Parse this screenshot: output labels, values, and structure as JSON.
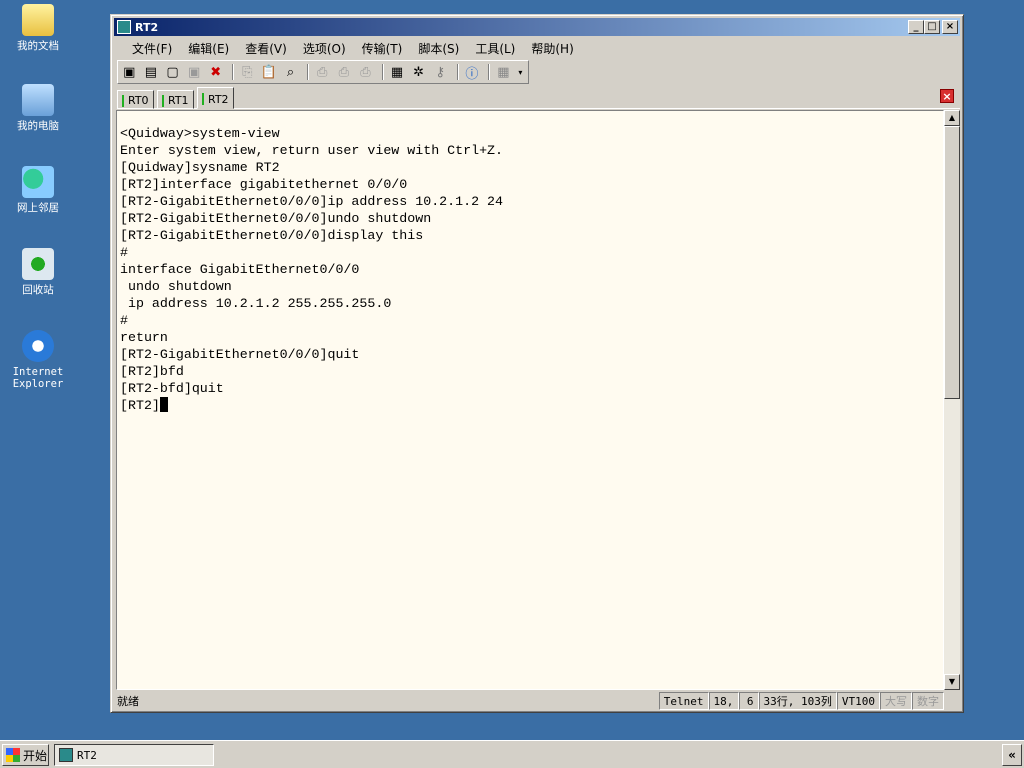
{
  "desktop": {
    "icons": [
      {
        "label": "我的文档",
        "icon": "folder-documents-icon"
      },
      {
        "label": "我的电脑",
        "icon": "computer-icon"
      },
      {
        "label": "网上邻居",
        "icon": "network-icon"
      },
      {
        "label": "回收站",
        "icon": "recycle-bin-icon"
      },
      {
        "label": "Internet Explorer",
        "icon": "internet-explorer-icon"
      }
    ]
  },
  "window": {
    "title": "RT2",
    "menu": [
      "文件(F)",
      "编辑(E)",
      "查看(V)",
      "选项(O)",
      "传输(T)",
      "脚本(S)",
      "工具(L)",
      "帮助(H)"
    ],
    "tabs": [
      "RT0",
      "RT1",
      "RT2"
    ],
    "active_tab": "RT2",
    "terminal_lines": [
      "<Quidway>system-view",
      "Enter system view, return user view with Ctrl+Z.",
      "[Quidway]sysname RT2",
      "[RT2]interface gigabitethernet 0/0/0",
      "[RT2-GigabitEthernet0/0/0]ip address 10.2.1.2 24",
      "[RT2-GigabitEthernet0/0/0]undo shutdown",
      "[RT2-GigabitEthernet0/0/0]display this",
      "#",
      "interface GigabitEthernet0/0/0",
      " undo shutdown",
      " ip address 10.2.1.2 255.255.255.0",
      "#",
      "return",
      "[RT2-GigabitEthernet0/0/0]quit",
      "[RT2]bfd",
      "[RT2-bfd]quit",
      "[RT2]"
    ],
    "status": {
      "ready": "就绪",
      "protocol": "Telnet",
      "cursor_row": "18,",
      "cursor_col": "6",
      "size": "33行, 103列",
      "emulation": "VT100",
      "caps": "大写",
      "num": "数字"
    }
  },
  "taskbar": {
    "start": "开始",
    "task": "RT2",
    "tray_toggle": "«"
  }
}
